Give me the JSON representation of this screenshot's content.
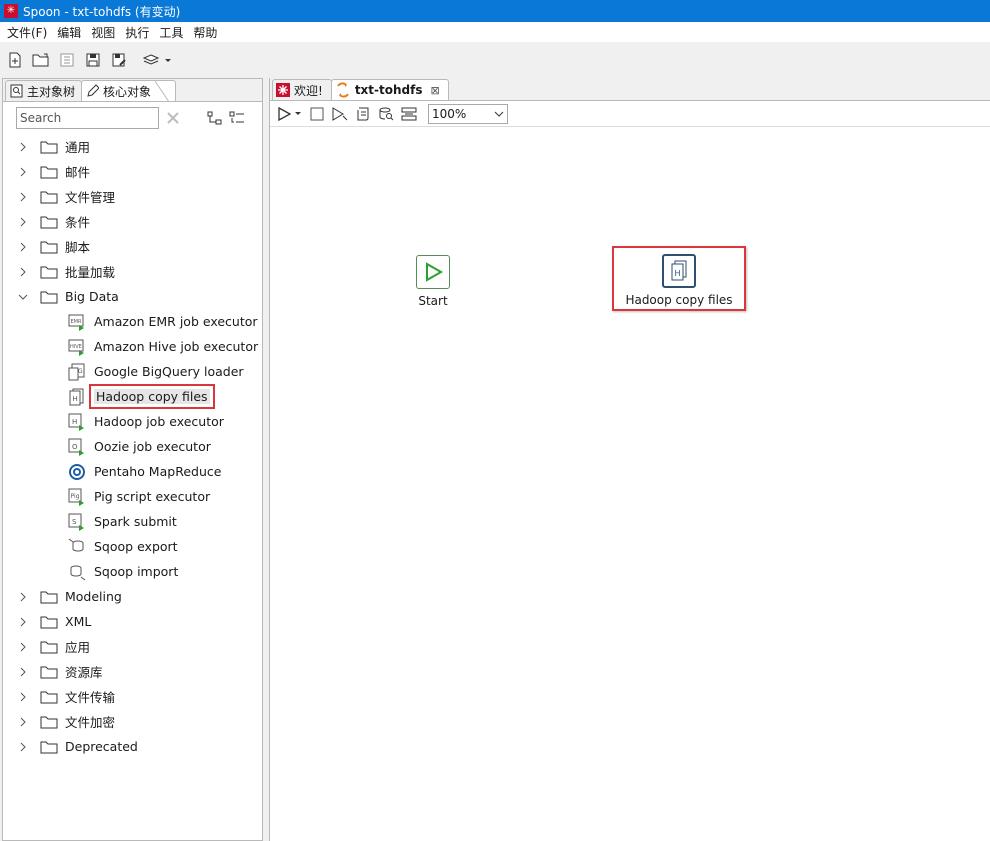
{
  "window": {
    "title": "Spoon - txt-tohdfs (有变动)"
  },
  "menu": [
    "文件(F)",
    "编辑",
    "视图",
    "执行",
    "工具",
    "帮助"
  ],
  "left_panel": {
    "tabs": [
      {
        "label": "主对象树",
        "icon": "tree-icon"
      },
      {
        "label": "核心对象",
        "icon": "pencil-icon"
      }
    ],
    "search_placeholder": "Search",
    "tree": [
      {
        "label": "通用",
        "expanded": false
      },
      {
        "label": "邮件",
        "expanded": false
      },
      {
        "label": "文件管理",
        "expanded": false
      },
      {
        "label": "条件",
        "expanded": false
      },
      {
        "label": "脚本",
        "expanded": false
      },
      {
        "label": "批量加载",
        "expanded": false
      },
      {
        "label": "Big Data",
        "expanded": true,
        "children": [
          {
            "label": "Amazon EMR job executor",
            "icon": "emr-icon"
          },
          {
            "label": "Amazon Hive job executor",
            "icon": "hive-icon"
          },
          {
            "label": "Google BigQuery loader",
            "icon": "bigquery-icon"
          },
          {
            "label": "Hadoop copy files",
            "icon": "hadoop-copy-icon",
            "highlighted": true
          },
          {
            "label": "Hadoop job executor",
            "icon": "hadoop-job-icon"
          },
          {
            "label": "Oozie job executor",
            "icon": "oozie-icon"
          },
          {
            "label": "Pentaho MapReduce",
            "icon": "mapreduce-icon"
          },
          {
            "label": "Pig script executor",
            "icon": "pig-icon"
          },
          {
            "label": "Spark submit",
            "icon": "spark-icon"
          },
          {
            "label": "Sqoop export",
            "icon": "sqoop-export-icon"
          },
          {
            "label": "Sqoop import",
            "icon": "sqoop-import-icon"
          }
        ]
      },
      {
        "label": "Modeling",
        "expanded": false
      },
      {
        "label": "XML",
        "expanded": false
      },
      {
        "label": "应用",
        "expanded": false
      },
      {
        "label": "资源库",
        "expanded": false
      },
      {
        "label": "文件传输",
        "expanded": false
      },
      {
        "label": "文件加密",
        "expanded": false
      },
      {
        "label": "Deprecated",
        "expanded": false
      }
    ]
  },
  "right_panel": {
    "tabs": [
      {
        "label": "欢迎!",
        "active": false,
        "icon": "spoon-icon"
      },
      {
        "label": "txt-tohdfs",
        "active": true,
        "icon": "job-icon",
        "closable": true
      }
    ],
    "zoom": "100%",
    "canvas": {
      "nodes": [
        {
          "label": "Start",
          "icon": "start-icon"
        },
        {
          "label": "Hadoop copy files",
          "icon": "hadoop-copy-icon",
          "highlighted": true
        }
      ]
    }
  },
  "colors": {
    "titlebar": "#0a78d7",
    "highlight_box": "#d9363e",
    "start_green": "#2e9e2e",
    "hadoop_node_border": "#2f4f6f"
  }
}
